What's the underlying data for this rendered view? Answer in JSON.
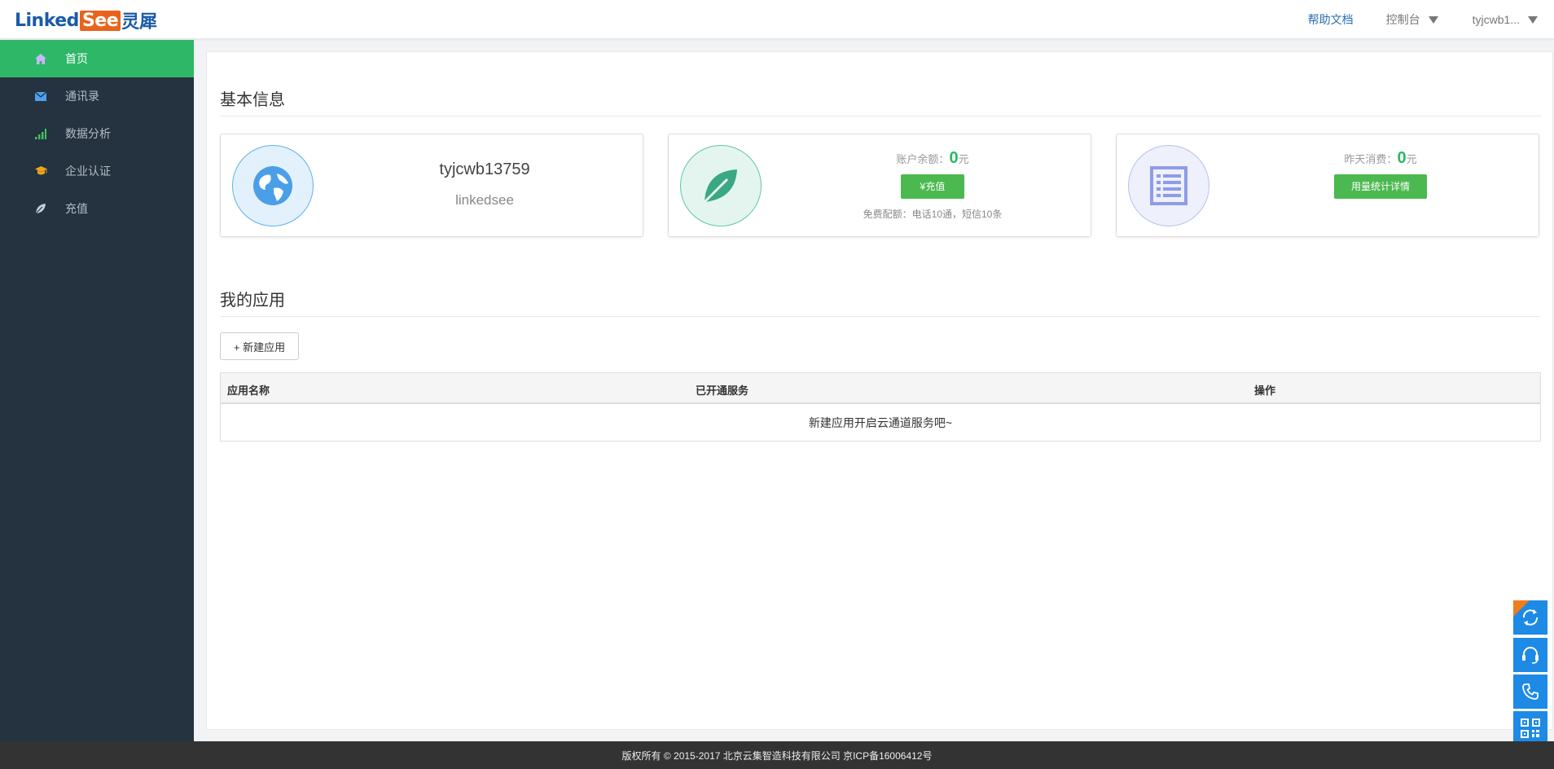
{
  "header": {
    "logo_part1": "Linked",
    "logo_part2": "See",
    "logo_part3": "灵犀",
    "help_docs": "帮助文档",
    "console": "控制台",
    "user": "tyjcwb1..."
  },
  "sidebar": {
    "items": [
      {
        "label": "首页",
        "icon": "home-icon",
        "active": true
      },
      {
        "label": "通讯录",
        "icon": "envelope-icon",
        "active": false
      },
      {
        "label": "数据分析",
        "icon": "signal-bars-icon",
        "active": false
      },
      {
        "label": "企业认证",
        "icon": "graduation-cap-icon",
        "active": false
      },
      {
        "label": "充值",
        "icon": "leaf-icon",
        "active": false
      }
    ]
  },
  "basic_info": {
    "title": "基本信息",
    "username": "tyjcwb13759",
    "org": "linkedsee",
    "balance_label": "账户余额：",
    "balance_value": "0",
    "balance_unit": "元",
    "recharge_btn": "¥充值",
    "free_quota": "免费配额：电话10通，短信10条",
    "yesterday_label": "昨天消费：",
    "yesterday_value": "0",
    "yesterday_unit": "元",
    "usage_btn": "用量统计详情"
  },
  "apps": {
    "title": "我的应用",
    "new_btn": "+ 新建应用",
    "columns": [
      "应用名称",
      "已开通服务",
      "操作"
    ],
    "empty_text": "新建应用开启云通道服务吧~"
  },
  "float_widgets": [
    "refresh-icon",
    "headset-icon",
    "phone-icon",
    "qrcode-icon"
  ],
  "footer": {
    "text": "版权所有 © 2015-2017 北京云集智造科技有限公司 京ICP备16006412号"
  },
  "colors": {
    "accent_green": "#2eb767",
    "sidebar_bg": "#253340",
    "brand_blue": "#1a5ba8",
    "brand_orange": "#e8641c",
    "widget_blue": "#1d8ae6"
  }
}
